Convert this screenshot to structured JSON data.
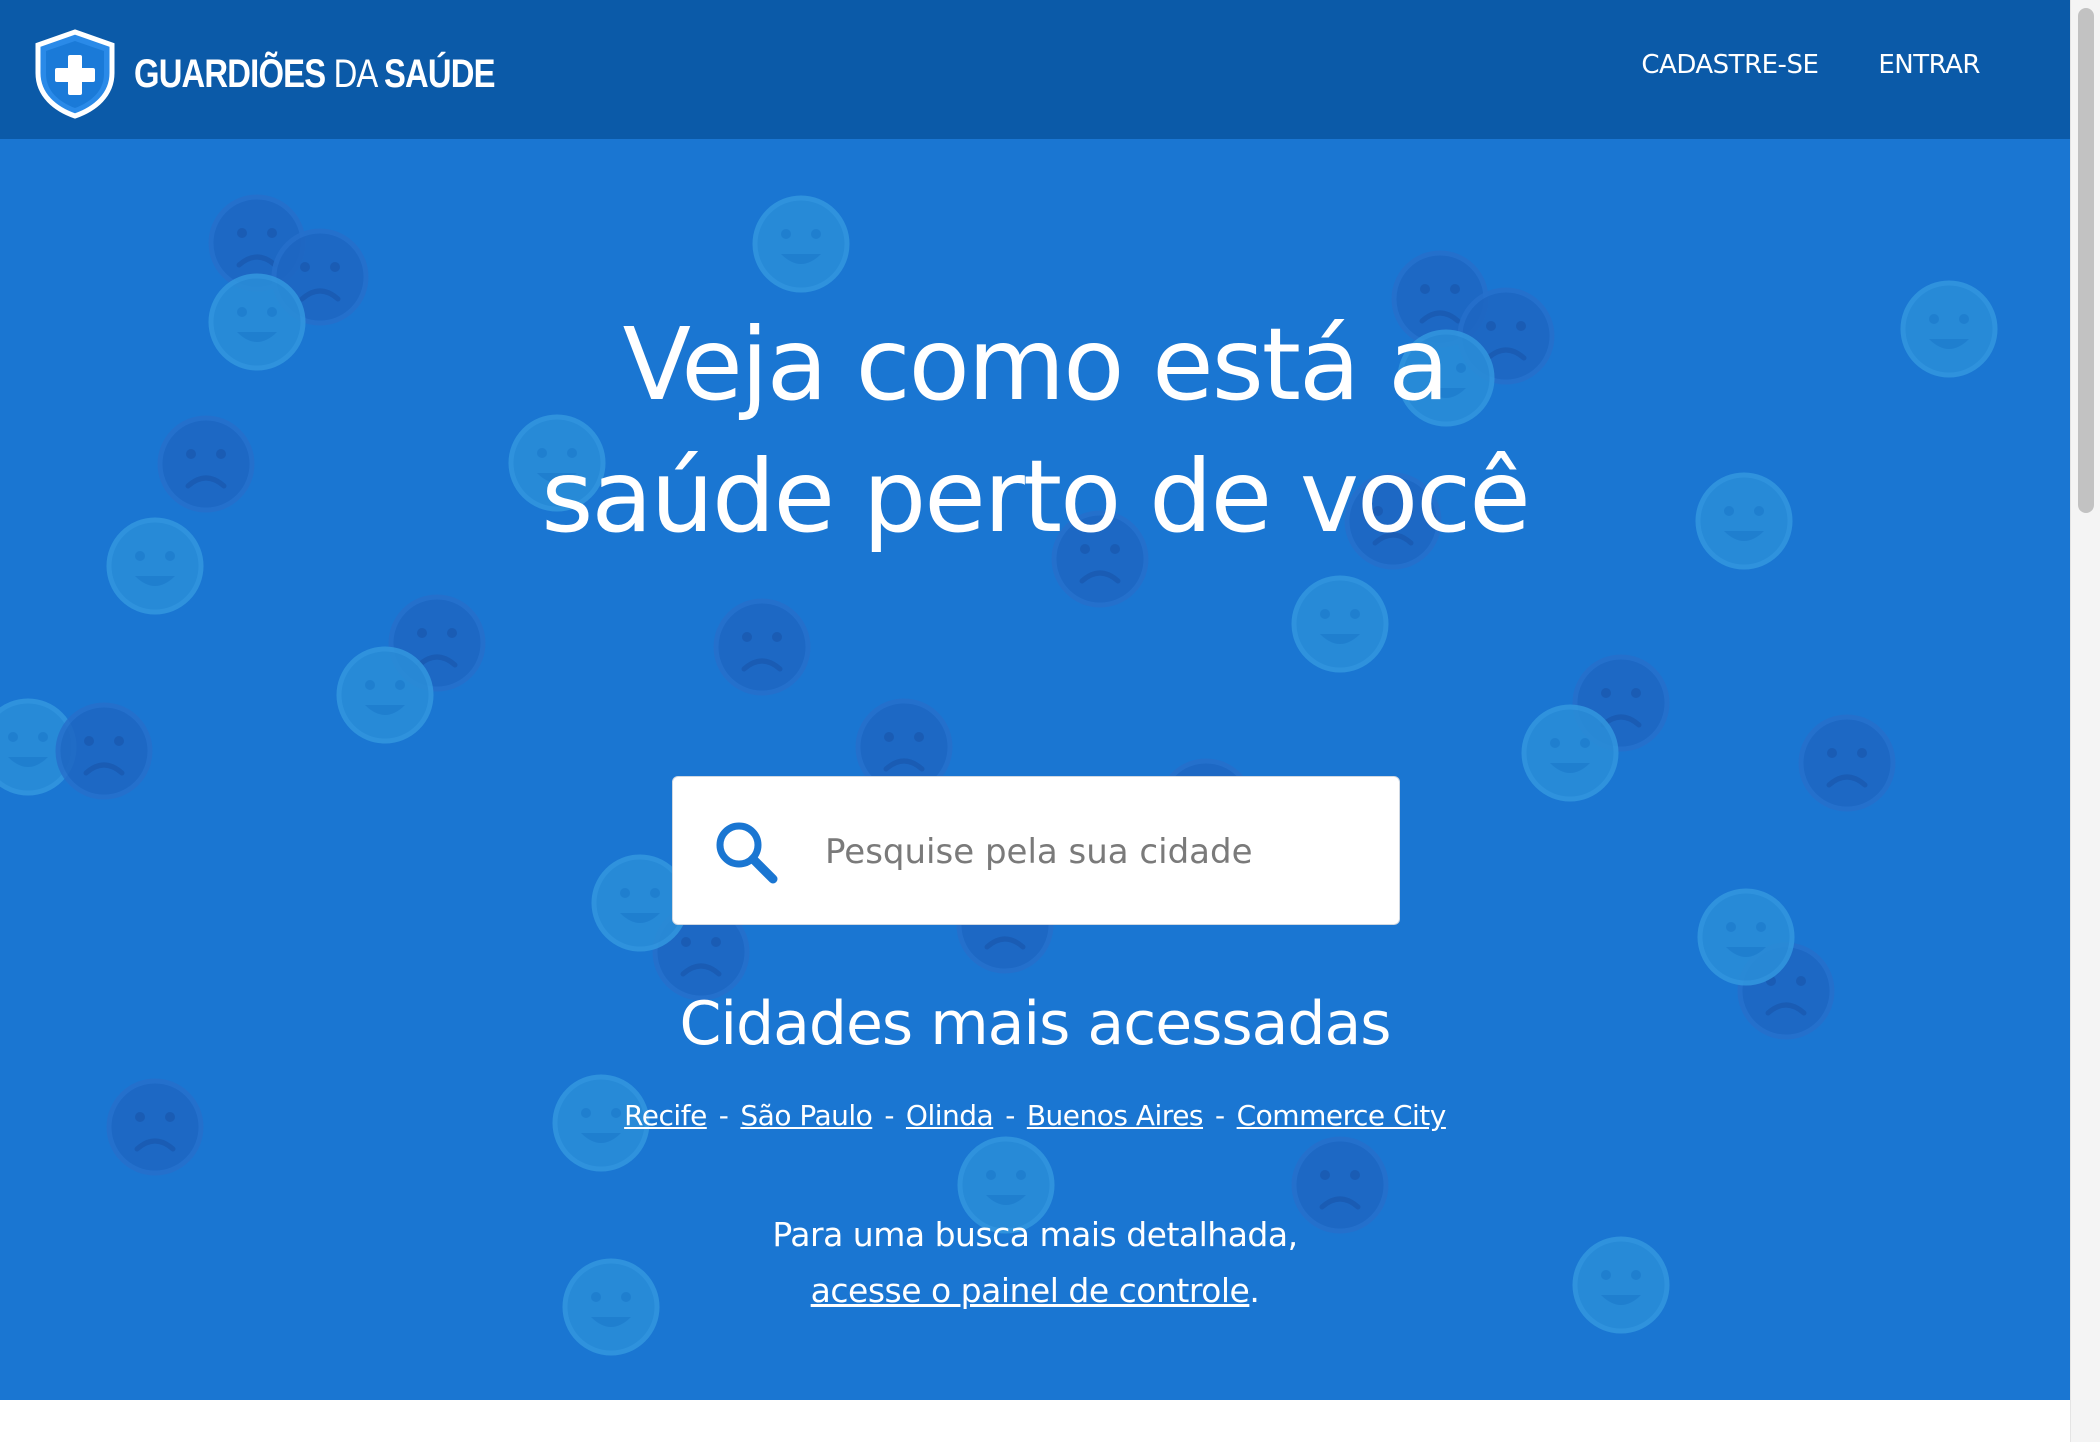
{
  "header": {
    "logo_bold": "Guardiões",
    "logo_light": "da",
    "logo_bold2": "Saúde",
    "nav": [
      {
        "label": "CADASTRE-SE"
      },
      {
        "label": "ENTRAR"
      }
    ]
  },
  "hero": {
    "title": "Veja como está a saúde perto de você",
    "search": {
      "placeholder": "Pesquise pela sua cidade"
    },
    "popular_title": "Cidades mais acessadas",
    "cities": [
      "Recife",
      "São Paulo",
      "Olinda",
      "Buenos Aires",
      "Commerce City"
    ],
    "city_separator": "-",
    "detail_line1": "Para uma busca mais detalhada,",
    "detail_link": "acesse o painel de controle",
    "detail_end": "."
  },
  "colors": {
    "navbar": "#0b5aa8",
    "hero": "#1a76d2",
    "white": "#ffffff"
  },
  "icons": {
    "logo": "shield-cross-icon",
    "search": "search-icon",
    "background": "face-icon"
  }
}
